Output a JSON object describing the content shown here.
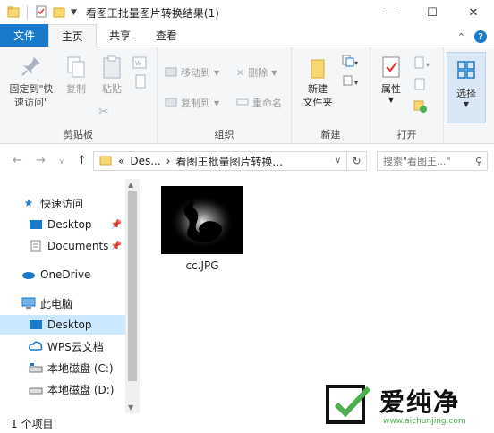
{
  "window": {
    "title": "看图王批量图片转换结果(1)",
    "min_glyph": "—",
    "max_glyph": "☐",
    "close_glyph": "✕"
  },
  "tabs": {
    "file": "文件",
    "home": "主页",
    "share": "共享",
    "view": "查看",
    "help_glyph": "?"
  },
  "ribbon": {
    "clipboard": {
      "label": "剪贴板",
      "pin": "固定到\"快速访问\"",
      "copy": "复制",
      "paste": "粘贴"
    },
    "organize": {
      "label": "组织",
      "move_to": "移动到",
      "copy_to": "复制到",
      "delete": "删除",
      "rename": "重命名"
    },
    "new": {
      "label": "新建",
      "new_folder": "新建\n文件夹"
    },
    "open": {
      "label": "打开",
      "properties": "属性"
    },
    "select": {
      "label": "选择"
    }
  },
  "address": {
    "prefix": "«",
    "seg1": "Des...",
    "sep": "›",
    "seg2": "看图王批量图片转换...",
    "search_placeholder": "搜索\"看图王...\""
  },
  "nav": {
    "quick_access": "快速访问",
    "desktop": "Desktop",
    "documents": "Documents",
    "onedrive": "OneDrive",
    "this_pc": "此电脑",
    "desktop2": "Desktop",
    "wps": "WPS云文档",
    "local_c": "本地磁盘 (C:)",
    "local_d": "本地磁盘 (D:)"
  },
  "files": [
    {
      "name": "cc.JPG"
    }
  ],
  "status": {
    "count": "1 个项目"
  },
  "watermark": {
    "text": "爱纯净",
    "url": "www.aichunjing.com"
  },
  "colors": {
    "accent": "#1979ca",
    "selection": "#cce8ff",
    "folder": "#f8d775"
  }
}
